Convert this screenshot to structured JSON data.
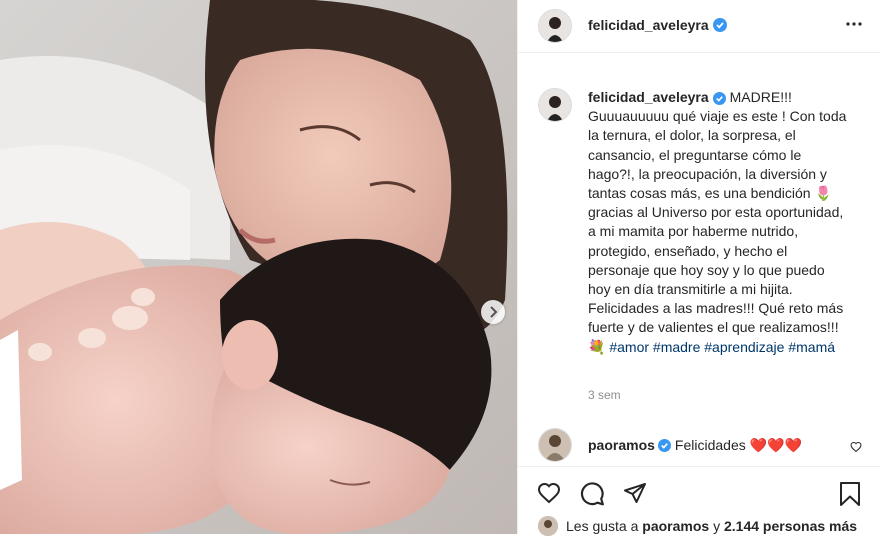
{
  "post": {
    "username": "felicidad_aveleyra",
    "caption": "MADRE!!! Guuuauuuuu qué viaje es este ! Con toda la ternura, el dolor, la sorpresa, el cansancio, el preguntarse cómo le hago?!, la preocupación, la diversión y tantas cosas más, es una bendición 🌷 gracias al Universo por esta oportunidad, a mi mamita por haberme nutrido, protegido, enseñado, y hecho el personaje que hoy soy y lo que puedo hoy en día transmitirle a mi hijita. Felicidades a las madres!!! Qué reto más fuerte y de valientes el que realizamos!!! 💐",
    "hashtags": [
      "#amor",
      "#madre",
      "#aprendizaje",
      "#mamá"
    ],
    "time_ago": "3 sem"
  },
  "comment": {
    "username": "paoramos",
    "text": "Felicidades ❤️❤️❤️"
  },
  "likes": {
    "prefix": "Les gusta a",
    "user": "paoramos",
    "middle": "y",
    "count": "2.144 personas más"
  },
  "icons": {
    "verified": "verified-badge-icon",
    "more": "more-options-icon",
    "next": "chevron-right-icon",
    "like": "heart-outline-icon",
    "comment": "comment-bubble-icon",
    "share": "paper-plane-icon",
    "save": "bookmark-icon"
  },
  "colors": {
    "verified": "#3897f0",
    "hashtag": "#00376b",
    "time": "#8e8e8e",
    "heart": "#ed4956"
  }
}
